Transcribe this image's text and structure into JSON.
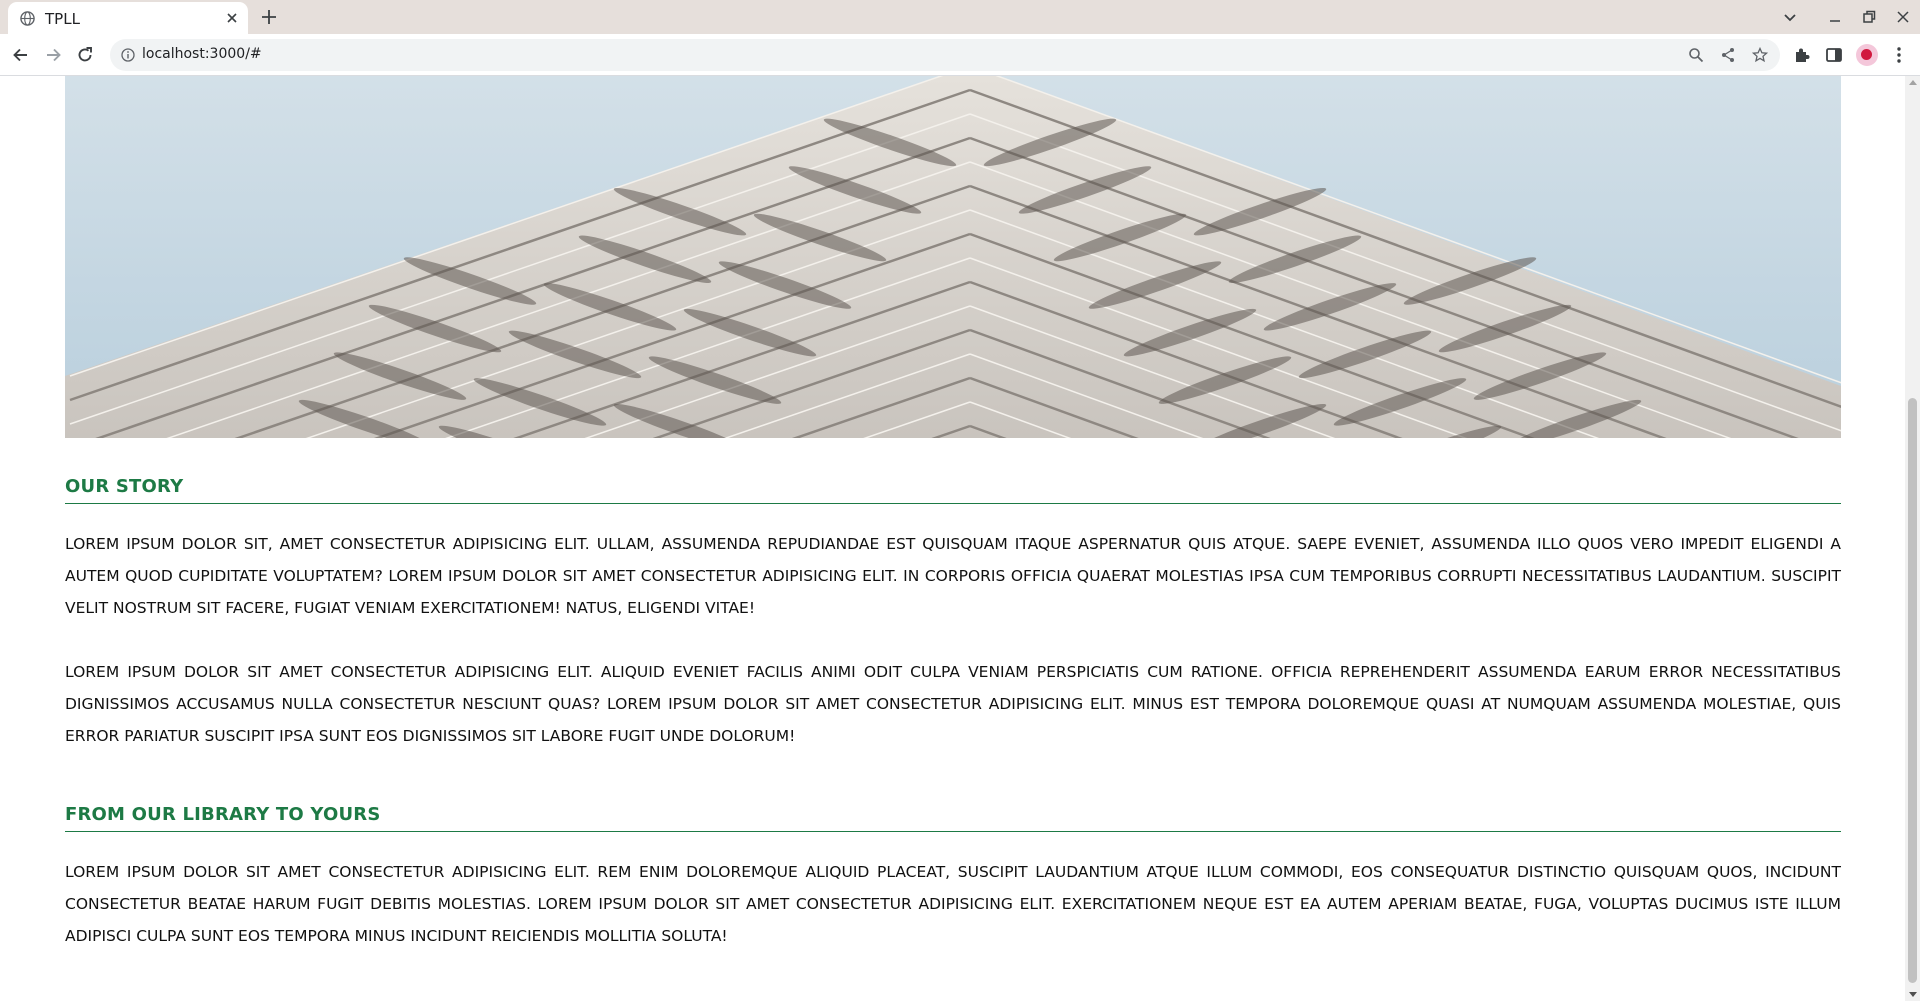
{
  "browser": {
    "tab_title": "TPLL",
    "url": "localhost:3000/#",
    "accent_color": "#e6dfdb",
    "icons": {
      "favicon": "globe-icon",
      "tab_close": "close-icon",
      "new_tab": "plus-icon",
      "tab_search": "chevron-down-icon",
      "back": "back-arrow-icon",
      "forward": "forward-arrow-icon",
      "reload": "reload-icon",
      "site_info": "info-icon",
      "zoom": "magnifier-icon",
      "share": "share-icon",
      "bookmark": "star-icon",
      "extensions": "puzzle-icon",
      "side_panel": "side-panel-icon",
      "profile": "avatar",
      "menu": "kebab-menu-icon"
    }
  },
  "page": {
    "theme_color": "#1d7a45",
    "hero_image": "architecture-building-facade",
    "sections": [
      {
        "title": "OUR STORY",
        "paragraphs": [
          "Lorem ipsum dolor sit, amet consectetur adipisicing elit. Ullam, assumenda repudiandae est quisquam itaque aspernatur quis atque. Saepe eveniet, assumenda illo quos vero impedit eligendi a autem quod cupiditate voluptatem? Lorem ipsum dolor sit amet consectetur adipisicing elit. In corporis officia quaerat molestias ipsa cum temporibus corrupti necessitatibus laudantium. Suscipit velit nostrum sit facere, fugiat veniam exercitationem! Natus, eligendi vitae!",
          "Lorem ipsum dolor sit amet consectetur adipisicing elit. Aliquid eveniet facilis animi odit culpa veniam perspiciatis cum ratione. Officia reprehenderit assumenda earum error necessitatibus dignissimos accusamus nulla consectetur nesciunt quas? Lorem ipsum dolor sit amet consectetur adipisicing elit. Minus est tempora doloremque quasi at numquam assumenda molestiae, quis error pariatur suscipit ipsa sunt eos dignissimos sit labore fugit unde dolorum!"
        ]
      },
      {
        "title": "FROM OUR LIBRARY TO YOURS",
        "paragraphs": [
          "Lorem ipsum dolor sit amet consectetur adipisicing elit. Rem enim doloremque aliquid placeat, suscipit laudantium atque illum commodi, eos consequatur distinctio quisquam quos, incidunt consectetur beatae harum fugit debitis molestias. Lorem ipsum dolor sit amet consectetur adipisicing elit. Exercitationem neque est ea autem aperiam beatae, fuga, voluptas ducimus iste illum adipisci culpa sunt eos tempora minus incidunt reiciendis mollitia soluta!"
        ]
      }
    ]
  }
}
